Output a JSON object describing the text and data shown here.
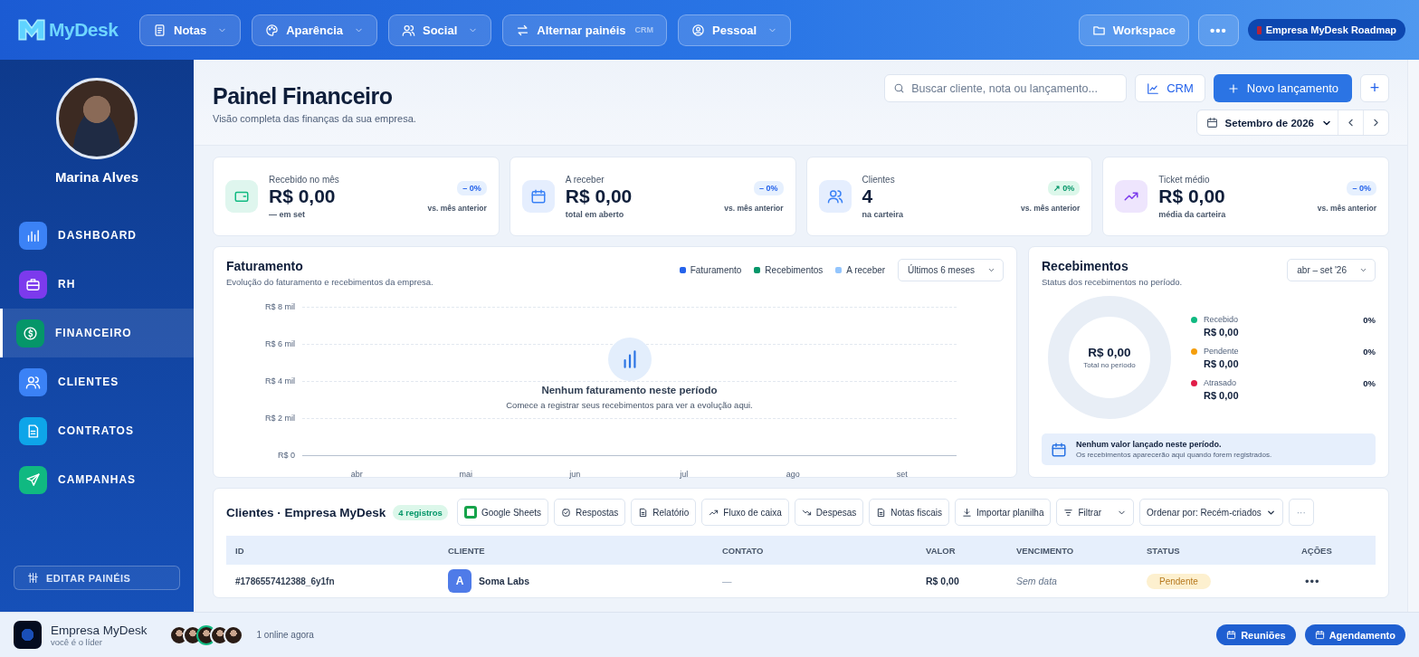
{
  "header": {
    "brand": "MyDesk",
    "nav": [
      {
        "label": "Notas",
        "caret": true
      },
      {
        "label": "Aparência",
        "caret": true
      },
      {
        "label": "Social",
        "caret": true
      },
      {
        "label": "Alternar painéis",
        "tag": "CRM",
        "caret": false
      },
      {
        "label": "Pessoal",
        "caret": true
      }
    ],
    "workspace": "Workspace",
    "more": "•••",
    "roadmap": "Empresa MyDesk Roadmap"
  },
  "sidebar": {
    "user_name": "Marina Alves",
    "items": [
      {
        "label": "DASHBOARD",
        "color": "#3b82f6",
        "selected": false
      },
      {
        "label": "RH",
        "color": "#7c3aed",
        "selected": false
      },
      {
        "label": "FINANCEIRO",
        "color": "#059669",
        "selected": true
      },
      {
        "label": "CLIENTES",
        "color": "#3b82f6",
        "selected": false
      },
      {
        "label": "CONTRATOS",
        "color": "#0ea5e9",
        "selected": false
      },
      {
        "label": "CAMPANHAS",
        "color": "#10b981",
        "selected": false
      }
    ],
    "edit_button": "EDITAR PAINÉIS"
  },
  "page": {
    "title": "Painel Financeiro",
    "subtitle": "Visão completa das finanças da sua empresa.",
    "search": {
      "placeholder": "Buscar cliente, nota ou lançamento..."
    },
    "crm_button": "CRM",
    "new_button": "Novo lançamento",
    "plus_button": "+",
    "month": "Setembro de 2026"
  },
  "kpis": [
    {
      "label": "Recebido no mês",
      "value": "R$ 0,00",
      "sub": "— em set",
      "badge": "– 0%",
      "kind": "flat",
      "compare": "vs. mês anterior",
      "color": "#10b981"
    },
    {
      "label": "A receber",
      "value": "R$ 0,00",
      "sub": "total em aberto",
      "badge": "– 0%",
      "kind": "flat",
      "compare": "vs. mês anterior",
      "color": "#3b82f6"
    },
    {
      "label": "Clientes",
      "value": "4",
      "sub": "na carteira",
      "badge": "↗ 0%",
      "kind": "up",
      "compare": "vs. mês anterior",
      "color": "#3b82f6"
    },
    {
      "label": "Ticket médio",
      "value": "R$ 0,00",
      "sub": "média da carteira",
      "badge": "– 0%",
      "kind": "flat",
      "compare": "vs. mês anterior",
      "color": "#7c3aed"
    }
  ],
  "billing": {
    "title": "Faturamento",
    "subtitle": "Evolução do faturamento e recebimentos da empresa.",
    "legend": [
      {
        "name": "Faturamento",
        "color": "#2563eb"
      },
      {
        "name": "Recebimentos",
        "color": "#059669"
      },
      {
        "name": "A receber",
        "color": "#93c5fd"
      }
    ],
    "period": "Últimos 6 meses",
    "y_labels": [
      "R$ 8 mil",
      "R$ 6 mil",
      "R$ 4 mil",
      "R$ 2 mil",
      "R$ 0"
    ],
    "x_labels": [
      "abr",
      "mai",
      "jun",
      "jul",
      "ago",
      "set"
    ],
    "empty_title": "Nenhum faturamento neste período",
    "empty_text": "Comece a registrar seus recebimentos para ver a evolução aqui."
  },
  "receipts": {
    "title": "Recebimentos",
    "subtitle": "Status dos recebimentos no período.",
    "period": "abr – set '26",
    "total": "R$ 0,00",
    "total_label": "Total no período",
    "legend": [
      {
        "name": "Recebido",
        "value": "R$ 0,00",
        "percent": "0%",
        "color": "#10b981"
      },
      {
        "name": "Pendente",
        "value": "R$ 0,00",
        "percent": "0%",
        "color": "#f59e0b"
      },
      {
        "name": "Atrasado",
        "value": "R$ 0,00",
        "percent": "0%",
        "color": "#e11d48"
      }
    ],
    "notice_title": "Nenhum valor lançado neste período.",
    "notice_text": "Os recebimentos aparecerão aqui quando forem registrados."
  },
  "clients": {
    "title": "Clientes · Empresa MyDesk",
    "count": "4 registros",
    "tools": [
      {
        "label": "Google Sheets"
      },
      {
        "label": "Respostas"
      },
      {
        "label": "Relatório"
      },
      {
        "label": "Fluxo de caixa"
      },
      {
        "label": "Despesas"
      },
      {
        "label": "Notas fiscais"
      },
      {
        "label": "Importar planilha"
      },
      {
        "label": "Filtrar",
        "caret": true
      }
    ],
    "sort": "Ordenar por: Recém-criados",
    "more": "···",
    "table": {
      "columns": [
        "ID",
        "CLIENTE",
        "CONTATO",
        "VALOR",
        "VENCIMENTO",
        "STATUS",
        "AÇÕES"
      ],
      "rows": [
        {
          "id": "#1786557412388_6y1fn",
          "initial": "A",
          "client": "Soma Labs",
          "contact": "—",
          "value": "R$ 0,00",
          "due": "Sem data",
          "status": "Pendente",
          "actions": "•••"
        }
      ]
    }
  },
  "footer": {
    "company": "Empresa MyDesk",
    "role": "você é o líder",
    "members": [
      {
        "online": false
      },
      {
        "online": false
      },
      {
        "online": true
      },
      {
        "online": false
      },
      {
        "online": false
      }
    ],
    "online_text": "1 online agora",
    "buttons": [
      "Reuniões",
      "Agendamento"
    ]
  }
}
